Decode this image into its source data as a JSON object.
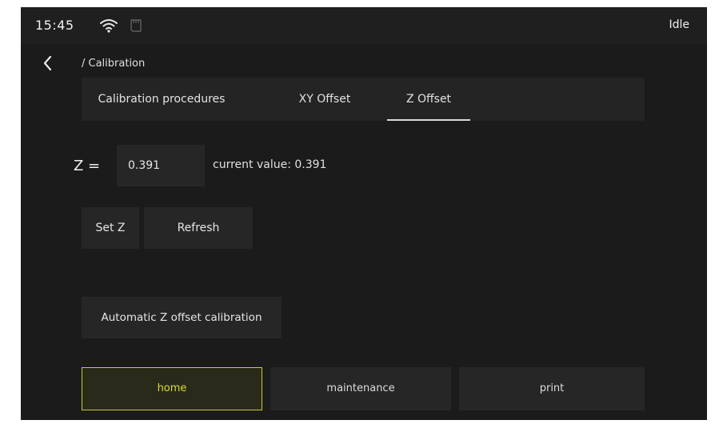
{
  "status_bar": {
    "time": "15:45",
    "printer_state": "Idle",
    "icons": [
      "wifi-icon",
      "sd-card-icon"
    ]
  },
  "header": {
    "back_icon": "chevron-left-icon",
    "breadcrumb": "/ Calibration"
  },
  "tabs": [
    {
      "label": "Calibration procedures",
      "active": false
    },
    {
      "label": "XY Offset",
      "active": false
    },
    {
      "label": "Z Offset",
      "active": true
    }
  ],
  "z_offset": {
    "label": "Z =",
    "input_value": "0.391",
    "current_value_text": "current value: 0.391"
  },
  "actions": {
    "set_z": "Set Z",
    "refresh": "Refresh",
    "auto_calibration": "Automatic Z offset calibration"
  },
  "bottom_nav": {
    "items": [
      {
        "label": "home",
        "active": true
      },
      {
        "label": "maintenance",
        "active": false
      },
      {
        "label": "print",
        "active": false
      }
    ]
  },
  "colors": {
    "background": "#1b1b1b",
    "panel": "#262626",
    "accent": "#c8cc2a",
    "text": "#e4e4e4"
  }
}
